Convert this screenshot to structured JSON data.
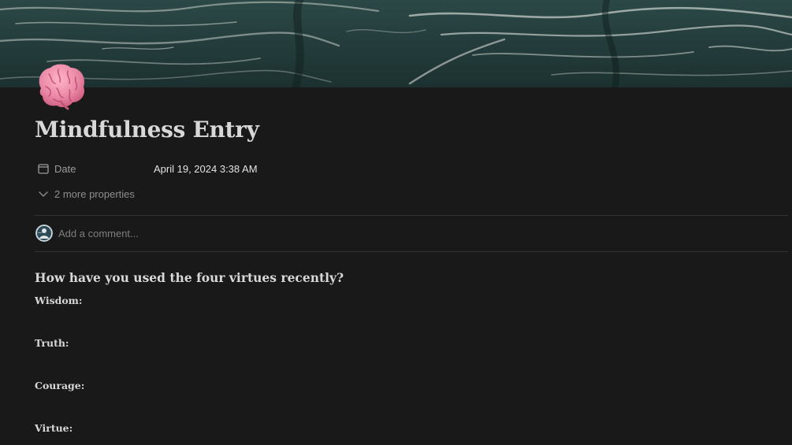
{
  "page": {
    "title": "Mindfulness Entry",
    "icon": "brain-emoji-icon",
    "cover": "dark-water-cover-image"
  },
  "properties": {
    "date_label": "Date",
    "date_value": "April 19, 2024 3:38 AM",
    "more_label": "2 more properties"
  },
  "comment": {
    "placeholder": "Add a comment..."
  },
  "content": {
    "heading": "How have you used the four virtues recently?",
    "virtues": [
      "Wisdom:",
      "Truth:",
      "Courage:",
      "Virtue:"
    ]
  },
  "colors": {
    "background": "#191919",
    "text": "#d8d8d8",
    "muted": "#9b9b9b",
    "divider": "#333333",
    "brain": "#e98aa8"
  }
}
